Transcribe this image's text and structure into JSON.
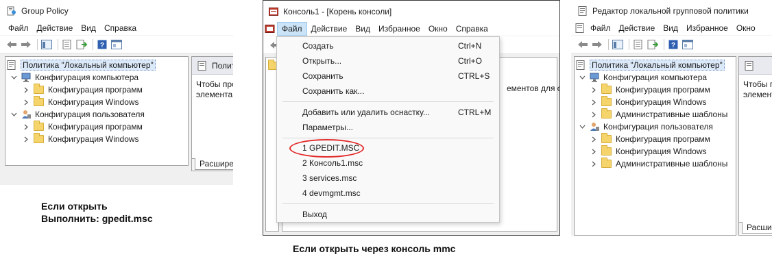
{
  "left": {
    "title": "Group Policy",
    "menu": [
      "Файл",
      "Действие",
      "Вид",
      "Справка"
    ],
    "tree": {
      "root": "Политика \"Локальный компьютер\"",
      "computer": "Конфигурация компьютера",
      "computer_children": [
        "Конфигурация программ",
        "Конфигурация Windows"
      ],
      "user": "Конфигурация пользователя",
      "user_children": [
        "Конфигурация программ",
        "Конфигурация Windows"
      ]
    },
    "panel": {
      "header": "Полит",
      "text_line1": "Чтобы про",
      "text_line2": "элемента,",
      "tab": "Расширен"
    }
  },
  "middle": {
    "title": "Консоль1 - [Корень консоли]",
    "menu": [
      "Файл",
      "Действие",
      "Вид",
      "Избранное",
      "Окно",
      "Справка"
    ],
    "background_text": "ементов для отс",
    "dropdown": {
      "items": [
        {
          "label": "Создать",
          "shortcut": "Ctrl+N"
        },
        {
          "label": "Открыть...",
          "shortcut": "Ctrl+O"
        },
        {
          "label": "Сохранить",
          "shortcut": "CTRL+S"
        },
        {
          "label": "Сохранить как...",
          "shortcut": ""
        },
        {
          "label": "Добавить или удалить оснастку...",
          "shortcut": "CTRL+M"
        },
        {
          "label": "Параметры...",
          "shortcut": ""
        },
        {
          "label": "1 GPEDIT.MSC",
          "shortcut": ""
        },
        {
          "label": "2 Консоль1.msc",
          "shortcut": ""
        },
        {
          "label": "3 services.msc",
          "shortcut": ""
        },
        {
          "label": "4 devmgmt.msc",
          "shortcut": ""
        },
        {
          "label": "Выход",
          "shortcut": ""
        }
      ]
    }
  },
  "right": {
    "title": "Редактор локальной групповой политики",
    "menu": [
      "Файл",
      "Действие",
      "Вид",
      "Избранное",
      "Окно"
    ],
    "tree": {
      "root": "Политика \"Локальный компьютер\"",
      "computer": "Конфигурация компьютера",
      "computer_children": [
        "Конфигурация программ",
        "Конфигурация Windows",
        "Административные шаблоны"
      ],
      "user": "Конфигурация пользователя",
      "user_children": [
        "Конфигурация программ",
        "Конфигурация Windows",
        "Административные шаблоны"
      ]
    },
    "panel": {
      "header": "",
      "text_line1": "Чтобы п",
      "text_line2": "элемент",
      "tab": "Расшир"
    }
  },
  "captions": {
    "left_line1": "Если открыть",
    "left_line2": "Выполнить: gpedit.msc",
    "middle": "Если открыть через консоль mmc"
  },
  "colors": {
    "selection": "#dbe9f9",
    "mmc_titlebar": "#ffffff",
    "highlight_ellipse": "#e32b2b",
    "menu_open": "#cce4f7"
  }
}
